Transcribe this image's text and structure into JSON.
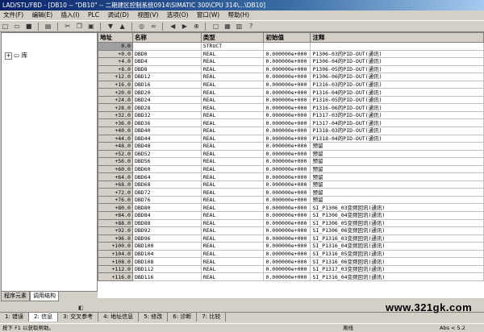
{
  "window": {
    "title": "LAD/STL/FBD  -  [DB10 -- \"DB10\" -- 二期建区控制系统0914\\SIMATIC 300\\CPU 314\\...\\DB10]"
  },
  "menu": [
    "文件(F)",
    "编辑(E)",
    "插入(I)",
    "PLC",
    "调试(D)",
    "视图(V)",
    "选项(O)",
    "窗口(W)",
    "帮助(H)"
  ],
  "left_panel": {
    "tree_item": "库",
    "tabs": [
      "程序元素",
      "调用结构"
    ]
  },
  "table": {
    "headers": [
      "地址",
      "名称",
      "类型",
      "初始值",
      "注释"
    ],
    "rows": [
      [
        "0.0",
        "",
        "STRUCT",
        "",
        ""
      ],
      [
        "+0.0",
        "DBD0",
        "REAL",
        "0.000000e+000",
        "P1306-03的PID-OUT(通讯)"
      ],
      [
        "+4.0",
        "DBD4",
        "REAL",
        "0.000000e+000",
        "P1306-04的PID-OUT(通讯)"
      ],
      [
        "+8.0",
        "DBD8",
        "REAL",
        "0.000000e+000",
        "P1306-05的PID-OUT(通讯)"
      ],
      [
        "+12.0",
        "DBD12",
        "REAL",
        "0.000000e+000",
        "P1306-06的PID-OUT(通讯)"
      ],
      [
        "+16.0",
        "DBD16",
        "REAL",
        "0.000000e+000",
        "P1316-03的PID-OUT(通讯)"
      ],
      [
        "+20.0",
        "DBD20",
        "REAL",
        "0.000000e+000",
        "P1316-04的PID-OUT(通讯)"
      ],
      [
        "+24.0",
        "DBD24",
        "REAL",
        "0.000000e+000",
        "P1316-05的PID-OUT(通讯)"
      ],
      [
        "+28.0",
        "DBD28",
        "REAL",
        "0.000000e+000",
        "P1316-06的PID-OUT(通讯)"
      ],
      [
        "+32.0",
        "DBD32",
        "REAL",
        "0.000000e+000",
        "P1317-03的PID-OUT(通讯)"
      ],
      [
        "+36.0",
        "DBD36",
        "REAL",
        "0.000000e+000",
        "P1317-04的PID-OUT(通讯)"
      ],
      [
        "+40.0",
        "DBD40",
        "REAL",
        "0.000000e+000",
        "P1318-03的PID-OUT(通讯)"
      ],
      [
        "+44.0",
        "DBD44",
        "REAL",
        "0.000000e+000",
        "P1318-04的PID-OUT(通讯)"
      ],
      [
        "+48.0",
        "DBD48",
        "REAL",
        "0.000000e+000",
        "预留"
      ],
      [
        "+52.0",
        "DBD52",
        "REAL",
        "0.000000e+000",
        "预留"
      ],
      [
        "+56.0",
        "DBD56",
        "REAL",
        "0.000000e+000",
        "预留"
      ],
      [
        "+60.0",
        "DBD60",
        "REAL",
        "0.000000e+000",
        "预留"
      ],
      [
        "+64.0",
        "DBD64",
        "REAL",
        "0.000000e+000",
        "预留"
      ],
      [
        "+68.0",
        "DBD68",
        "REAL",
        "0.000000e+000",
        "预留"
      ],
      [
        "+72.0",
        "DBD72",
        "REAL",
        "0.000000e+000",
        "预留"
      ],
      [
        "+76.0",
        "DBD76",
        "REAL",
        "0.000000e+000",
        "预留"
      ],
      [
        "+80.0",
        "DBD80",
        "REAL",
        "0.000000e+000",
        "SI_P1306_03变频回讯(通讯)"
      ],
      [
        "+84.0",
        "DBD84",
        "REAL",
        "0.000000e+000",
        "SI_P1306_04变频回讯(通讯)"
      ],
      [
        "+88.0",
        "DBD88",
        "REAL",
        "0.000000e+000",
        "SI_P1306_05变频回讯(通讯)"
      ],
      [
        "+92.0",
        "DBD92",
        "REAL",
        "0.000000e+000",
        "SI_P1306_06变频回讯(通讯)"
      ],
      [
        "+96.0",
        "DBD96",
        "REAL",
        "0.000000e+000",
        "SI_P1316_03变频回讯(通讯)"
      ],
      [
        "+100.0",
        "DBD100",
        "REAL",
        "0.000000e+000",
        "SI_P1316_04变频回讯(通讯)"
      ],
      [
        "+104.0",
        "DBD104",
        "REAL",
        "0.000000e+000",
        "SI_P1316_05变频回讯(通讯)"
      ],
      [
        "+108.0",
        "DBD108",
        "REAL",
        "0.000000e+000",
        "SI_P1316_06变频回讯(通讯)"
      ],
      [
        "+112.0",
        "DBD112",
        "REAL",
        "0.000000e+000",
        "SI_P1317_03变频回讯(通讯)"
      ],
      [
        "+116.0",
        "DBD116",
        "REAL",
        "0.000000e+000",
        "SI_P1316_04变频回讯(通讯)"
      ]
    ]
  },
  "bottom_tabs": [
    "1: 错误",
    "2: 信息",
    "3: 交叉参考",
    "4: 地址信息",
    "5: 修改",
    "6: 诊断",
    "7: 比较"
  ],
  "status": {
    "left": "按下 F1 以获取帮助。",
    "mid": "离线",
    "right": "Abs < 5.2"
  },
  "watermark": "www.321gk.com"
}
